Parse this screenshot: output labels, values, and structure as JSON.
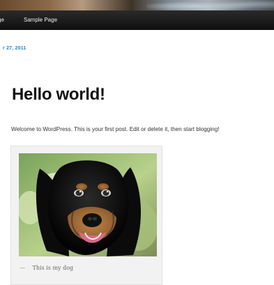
{
  "header": {
    "image_icon": "header-banner-image"
  },
  "nav": {
    "items": [
      {
        "label": "ge"
      },
      {
        "label": "Sample Page"
      }
    ]
  },
  "post": {
    "date": "r 27, 2011",
    "title": "Hello world!",
    "excerpt": "Welcome to WordPress. This is your first post. Edit or delete it, then start blogging!",
    "figure": {
      "image_icon": "dog-photo",
      "caption_dash": "—",
      "caption": "This is my dog"
    }
  },
  "colors": {
    "nav_background": "#111111",
    "nav_text": "#eeeeee",
    "date_link": "#1b8be0",
    "title_text": "#111111",
    "body_text": "#333333",
    "caption_bg": "#f2f2f2",
    "caption_text": "#666666"
  }
}
